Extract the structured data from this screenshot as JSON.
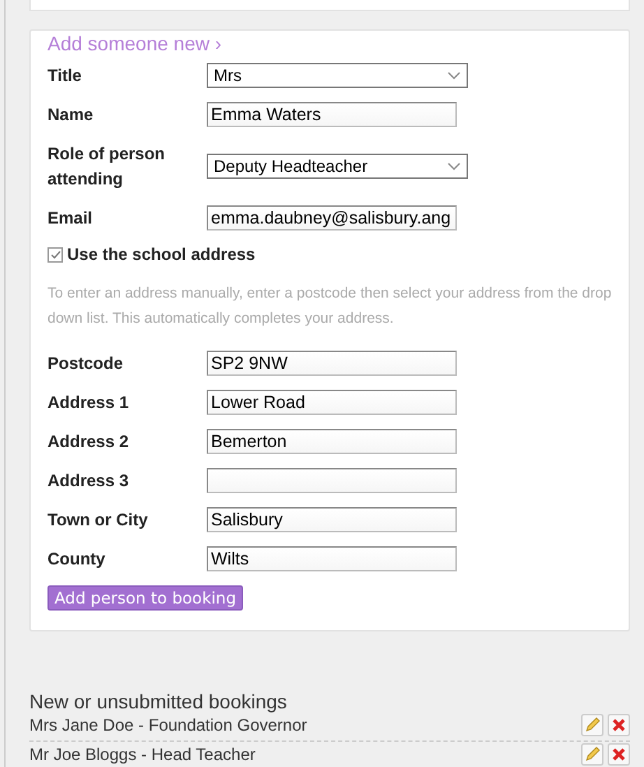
{
  "form": {
    "heading": "Add someone new ›",
    "fields": [
      {
        "kind": "select",
        "label": "Title",
        "value": "Mrs"
      },
      {
        "kind": "text",
        "label": "Name",
        "value": "Emma Waters"
      },
      {
        "kind": "select",
        "label": "Role of person attending",
        "value": "Deputy Headteacher"
      },
      {
        "kind": "text",
        "label": "Email",
        "value": "emma.daubney@salisbury.ang"
      }
    ],
    "school_address": {
      "label": "Use the school address",
      "checked": true
    },
    "help_text": "To enter an address manually, enter a postcode then select your address from the drop down list. This automatically completes your address.",
    "address_fields": [
      {
        "kind": "text",
        "label": "Postcode",
        "value": "SP2 9NW"
      },
      {
        "kind": "text",
        "label": "Address 1",
        "value": "Lower Road"
      },
      {
        "kind": "text",
        "label": "Address 2",
        "value": "Bemerton"
      },
      {
        "kind": "text",
        "label": "Address 3"
      },
      {
        "kind": "text",
        "label": "Town or City",
        "value": "Salisbury"
      },
      {
        "kind": "text",
        "label": "County",
        "value": "Wilts"
      }
    ],
    "submit": "Add person to booking"
  },
  "bookings": {
    "heading": "New or unsubmitted bookings",
    "rows": [
      {
        "text": "Mrs Jane Doe - Foundation Governor"
      },
      {
        "text": "Mr Joe Bloggs - Head Teacher"
      }
    ]
  }
}
